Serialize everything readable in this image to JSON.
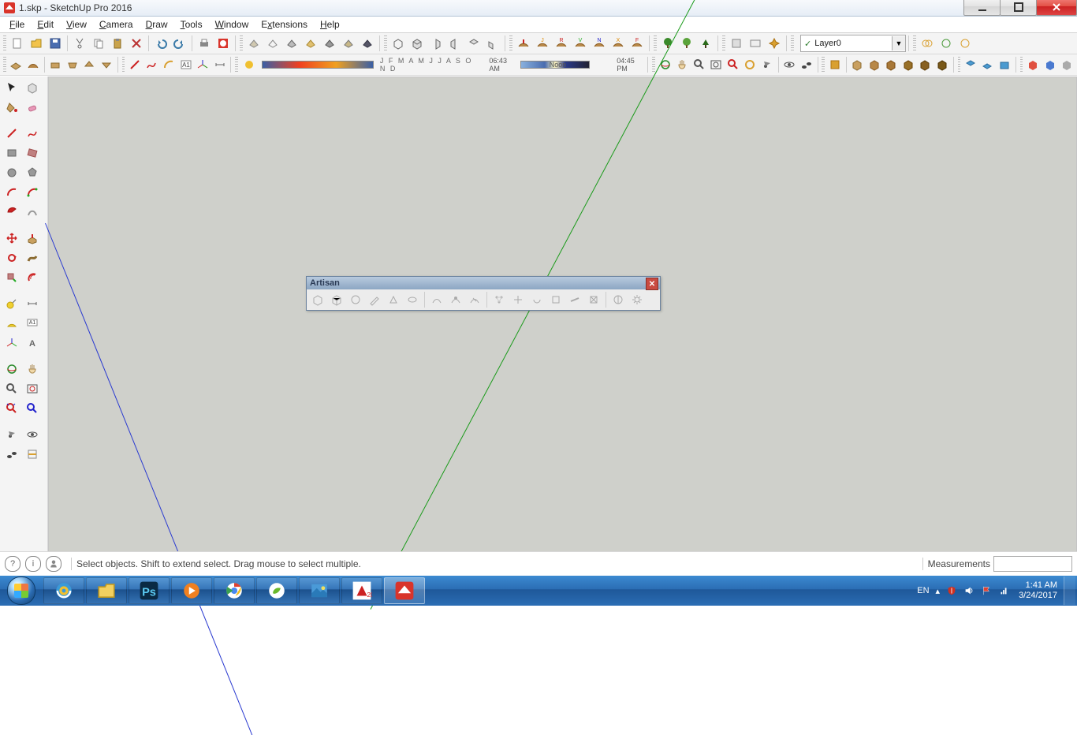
{
  "titlebar": {
    "filename": "1.skp",
    "app": "SketchUp Pro 2016"
  },
  "menu": [
    "File",
    "Edit",
    "View",
    "Camera",
    "Draw",
    "Tools",
    "Window",
    "Extensions",
    "Help"
  ],
  "layer": {
    "name": "Layer0"
  },
  "shadow": {
    "months": "J F M A M J J A S O N D",
    "time1": "06:43 AM",
    "time_noon": "Noon",
    "time2": "04:45 PM"
  },
  "status": {
    "hint": "Select objects. Shift to extend select. Drag mouse to select multiple.",
    "measure_label": "Measurements"
  },
  "float": {
    "title": "Artisan"
  },
  "tray": {
    "lang": "EN",
    "time": "1:41 AM",
    "date": "3/24/2017"
  }
}
